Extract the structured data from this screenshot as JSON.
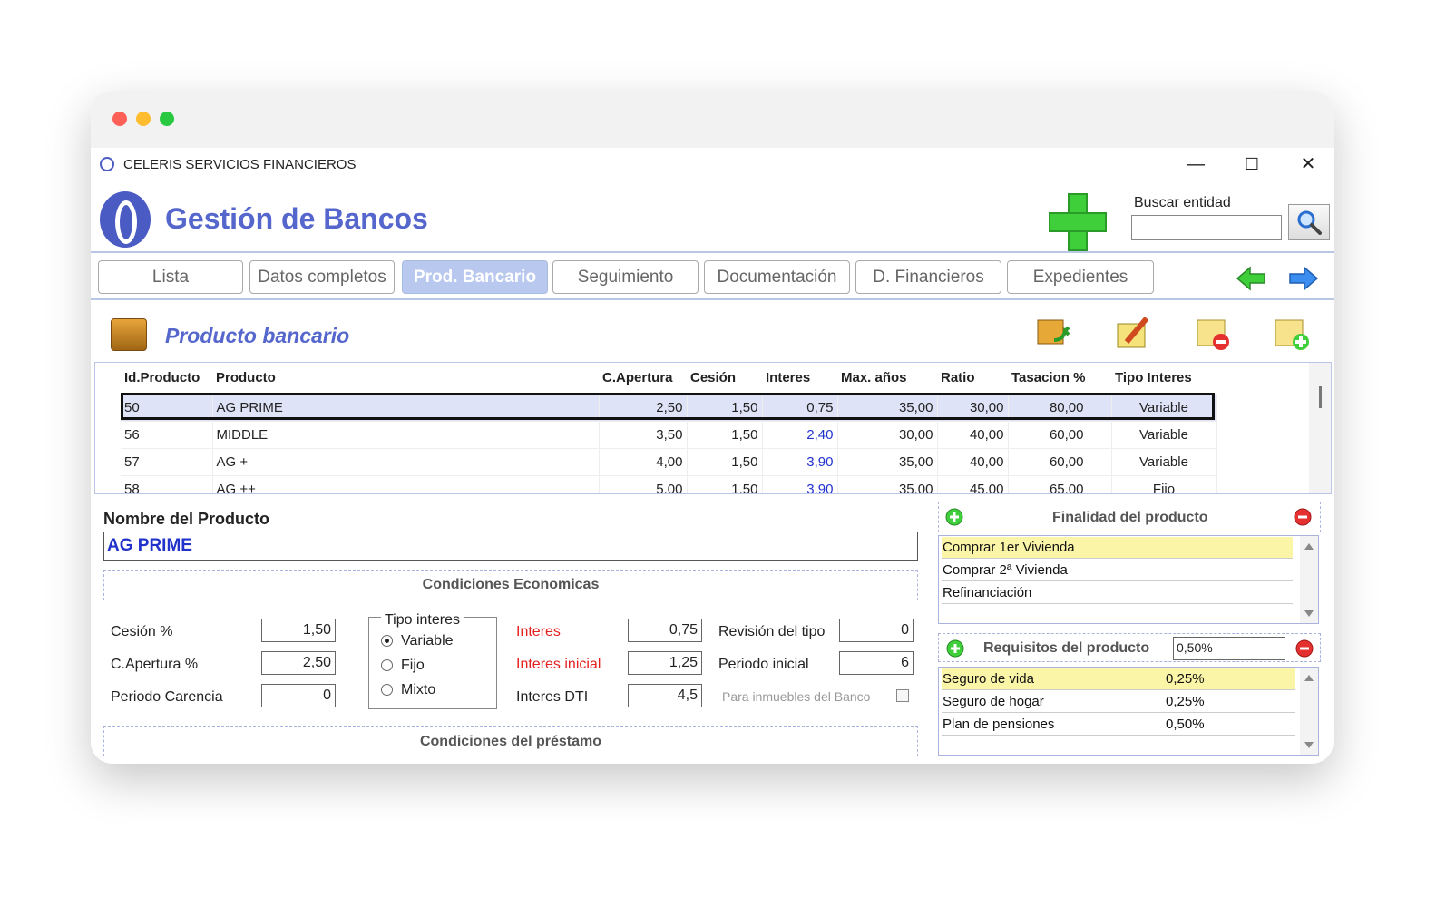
{
  "window": {
    "app_name": "CELERIS SERVICIOS FINANCIEROS",
    "minimize": "—",
    "maximize": "☐",
    "close": "✕"
  },
  "header": {
    "title": "Gestión de Bancos",
    "search_label": "Buscar entidad",
    "search_value": ""
  },
  "tabs": [
    {
      "label": "Lista"
    },
    {
      "label": "Datos completos"
    },
    {
      "label": "Prod. Bancario",
      "active": true
    },
    {
      "label": "Seguimiento"
    },
    {
      "label": "Documentación"
    },
    {
      "label": "D. Financieros"
    },
    {
      "label": "Expedientes"
    }
  ],
  "section": {
    "title": "Producto bancario"
  },
  "grid": {
    "columns": [
      "Id.Producto",
      "Producto",
      "C.Apertura",
      "Cesión",
      "Interes",
      "Max. años",
      "Ratio",
      "Tasacion %",
      "Tipo Interes"
    ],
    "rows": [
      [
        "50",
        "AG PRIME",
        "2,50",
        "1,50",
        "0,75",
        "35,00",
        "30,00",
        "80,00",
        "Variable"
      ],
      [
        "56",
        "MIDDLE",
        "3,50",
        "1,50",
        "2,40",
        "30,00",
        "40,00",
        "60,00",
        "Variable"
      ],
      [
        "57",
        "AG +",
        "4,00",
        "1,50",
        "3,90",
        "35,00",
        "40,00",
        "60,00",
        "Variable"
      ],
      [
        "58",
        "AG ++",
        "5,00",
        "1,50",
        "3,90",
        "35,00",
        "45,00",
        "65,00",
        "Fijo"
      ]
    ]
  },
  "form": {
    "name_label": "Nombre del Producto",
    "name_value": "AG PRIME",
    "cond_econ": "Condiciones Economicas",
    "cond_prest": "Condiciones del préstamo",
    "cesion_label": "Cesión %",
    "cesion_value": "1,50",
    "apertura_label": "C.Apertura %",
    "apertura_value": "2,50",
    "carencia_label": "Periodo Carencia",
    "carencia_value": "0",
    "tipo_legend": "Tipo  interes",
    "tipo_options": [
      "Variable",
      "Fijo",
      "Mixto"
    ],
    "interes_label": "Interes",
    "interes_value": "0,75",
    "interes_ini_label": "Interes inicial",
    "interes_ini_value": "1,25",
    "dti_label": "Interes DTI",
    "dti_value": "4,5",
    "revision_label": "Revisión del tipo",
    "revision_value": "0",
    "periodo_ini_label": "Periodo inicial",
    "periodo_ini_value": "6",
    "inmuebles_label": "Para inmuebles del Banco"
  },
  "finalidad": {
    "title": "Finalidad del producto",
    "items": [
      "Comprar 1er Vivienda",
      "Comprar 2ª Vivienda",
      "Refinanciación"
    ]
  },
  "requisitos": {
    "title": "Requisitos del producto",
    "input_value": "0,50%",
    "items": [
      {
        "name": "Seguro de vida",
        "value": "0,25%"
      },
      {
        "name": "Seguro de hogar",
        "value": "0,25%"
      },
      {
        "name": "Plan de pensiones",
        "value": "0,50%"
      }
    ]
  }
}
